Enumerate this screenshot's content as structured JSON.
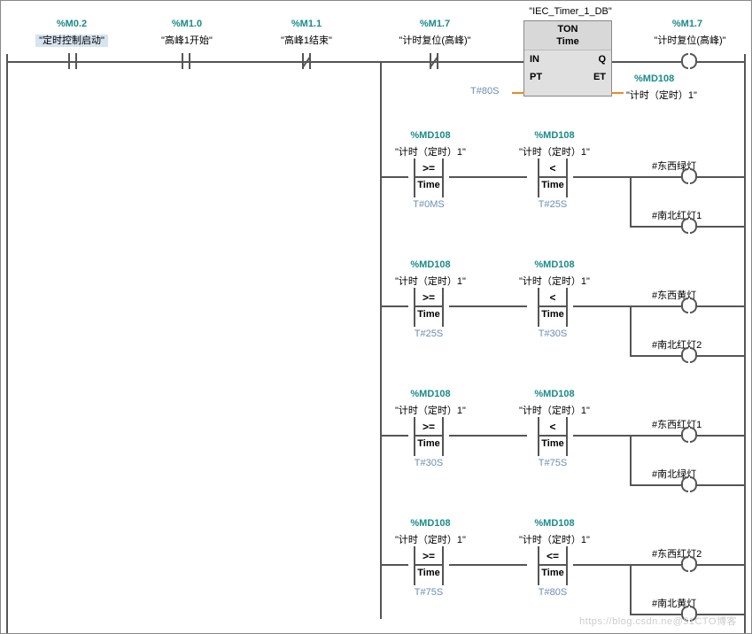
{
  "contacts": {
    "m02": {
      "addr": "%M0.2",
      "label": "\"定时控制启动\""
    },
    "m10": {
      "addr": "%M1.0",
      "label": "\"高峰1开始\""
    },
    "m11": {
      "addr": "%M1.1",
      "label": "\"高峰1结束\""
    },
    "m17a": {
      "addr": "%M1.7",
      "label": "\"计时复位(高峰)\""
    },
    "m17b": {
      "addr": "%M1.7",
      "label": "\"计时复位(高峰)\""
    }
  },
  "timer": {
    "db": "\"IEC_Timer_1_DB\"",
    "type": "TON",
    "subtype": "Time",
    "pins": {
      "in": "IN",
      "q": "Q",
      "pt": "PT",
      "et": "ET"
    },
    "pt_val": "T#80S",
    "et_addr": "%MD108",
    "et_label": "\"计时（定时）1\""
  },
  "compares": [
    {
      "left": {
        "addr": "%MD108",
        "label": "\"计时（定时）1\"",
        "op": ">=",
        "type": "Time",
        "val": "T#0MS"
      },
      "right": {
        "addr": "%MD108",
        "label": "\"计时（定时）1\"",
        "op": "<",
        "type": "Time",
        "val": "T#25S"
      },
      "outputs": [
        "#东西绿灯",
        "#南北红灯1"
      ]
    },
    {
      "left": {
        "addr": "%MD108",
        "label": "\"计时（定时）1\"",
        "op": ">=",
        "type": "Time",
        "val": "T#25S"
      },
      "right": {
        "addr": "%MD108",
        "label": "\"计时（定时）1\"",
        "op": "<",
        "type": "Time",
        "val": "T#30S"
      },
      "outputs": [
        "#东西黄灯",
        "#南北红灯2"
      ]
    },
    {
      "left": {
        "addr": "%MD108",
        "label": "\"计时（定时）1\"",
        "op": ">=",
        "type": "Time",
        "val": "T#30S"
      },
      "right": {
        "addr": "%MD108",
        "label": "\"计时（定时）1\"",
        "op": "<",
        "type": "Time",
        "val": "T#75S"
      },
      "outputs": [
        "#东西红灯1",
        "#南北绿灯"
      ]
    },
    {
      "left": {
        "addr": "%MD108",
        "label": "\"计时（定时）1\"",
        "op": ">=",
        "type": "Time",
        "val": "T#75S"
      },
      "right": {
        "addr": "%MD108",
        "label": "\"计时（定时）1\"",
        "op": "<=",
        "type": "Time",
        "val": "T#80S"
      },
      "outputs": [
        "#东西红灯2",
        "#南北黄灯"
      ]
    }
  ],
  "watermark": "https://blog.csdn.ne@51CTO博客"
}
